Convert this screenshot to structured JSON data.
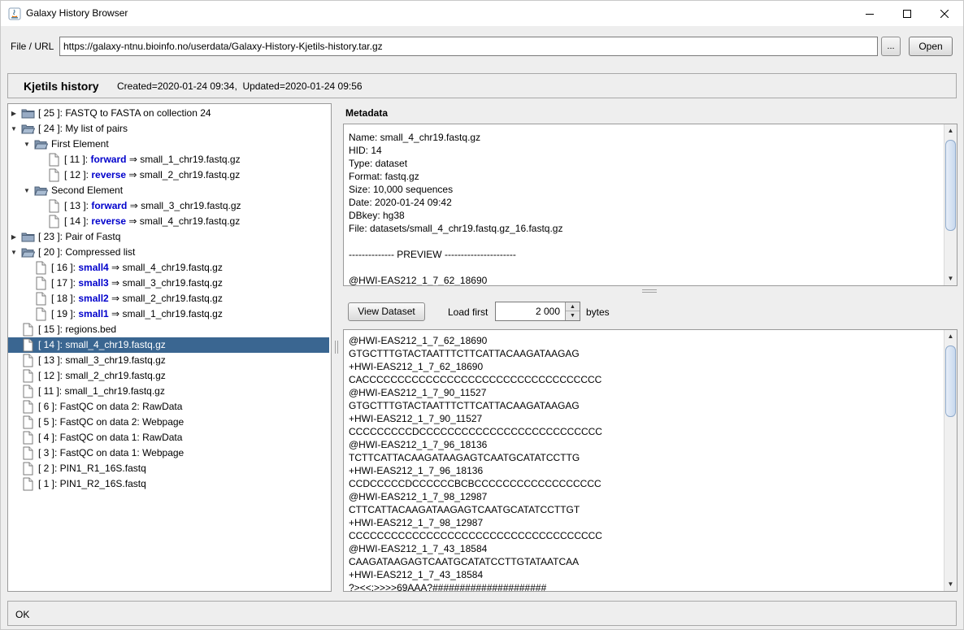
{
  "window": {
    "title": "Galaxy History Browser"
  },
  "url_row": {
    "label": "File / URL",
    "value": "https://galaxy-ntnu.bioinfo.no/userdata/Galaxy-History-Kjetils-history.tar.gz",
    "browse_label": "...",
    "open_label": "Open"
  },
  "history": {
    "name": "Kjetils history",
    "meta": "Created=2020-01-24 09:34,  Updated=2020-01-24 09:56"
  },
  "tree": [
    {
      "level": 0,
      "type": "folder",
      "expander": "right",
      "text": "[ 25 ]: FASTQ to FASTA on collection 24"
    },
    {
      "level": 0,
      "type": "folder-open",
      "expander": "down",
      "text": "[ 24 ]: My list of pairs"
    },
    {
      "level": 1,
      "type": "folder-open",
      "expander": "down",
      "text": "First Element"
    },
    {
      "level": 2,
      "type": "file",
      "prefix": "[ 11 ]: ",
      "label": "forward",
      "suffix": " ⇒ small_1_chr19.fastq.gz"
    },
    {
      "level": 2,
      "type": "file",
      "prefix": "[ 12 ]: ",
      "label": "reverse",
      "suffix": " ⇒ small_2_chr19.fastq.gz"
    },
    {
      "level": 1,
      "type": "folder-open",
      "expander": "down",
      "text": "Second Element"
    },
    {
      "level": 2,
      "type": "file",
      "prefix": "[ 13 ]: ",
      "label": "forward",
      "suffix": " ⇒ small_3_chr19.fastq.gz"
    },
    {
      "level": 2,
      "type": "file",
      "prefix": "[ 14 ]: ",
      "label": "reverse",
      "suffix": " ⇒ small_4_chr19.fastq.gz"
    },
    {
      "level": 0,
      "type": "folder",
      "expander": "right",
      "text": "[ 23 ]: Pair of Fastq"
    },
    {
      "level": 0,
      "type": "folder-open",
      "expander": "down",
      "text": "[ 20 ]: Compressed list"
    },
    {
      "level": 1,
      "type": "file",
      "prefix": "[ 16 ]: ",
      "label": "small4",
      "suffix": " ⇒ small_4_chr19.fastq.gz"
    },
    {
      "level": 1,
      "type": "file",
      "prefix": "[ 17 ]: ",
      "label": "small3",
      "suffix": " ⇒ small_3_chr19.fastq.gz"
    },
    {
      "level": 1,
      "type": "file",
      "prefix": "[ 18 ]: ",
      "label": "small2",
      "suffix": " ⇒ small_2_chr19.fastq.gz"
    },
    {
      "level": 1,
      "type": "file",
      "prefix": "[ 19 ]: ",
      "label": "small1",
      "suffix": " ⇒ small_1_chr19.fastq.gz"
    },
    {
      "level": 0,
      "type": "file",
      "text": "[ 15 ]: regions.bed"
    },
    {
      "level": 0,
      "type": "file",
      "text": "[ 14 ]: small_4_chr19.fastq.gz",
      "selected": true
    },
    {
      "level": 0,
      "type": "file",
      "text": "[ 13 ]: small_3_chr19.fastq.gz"
    },
    {
      "level": 0,
      "type": "file",
      "text": "[ 12 ]: small_2_chr19.fastq.gz"
    },
    {
      "level": 0,
      "type": "file",
      "text": "[ 11 ]: small_1_chr19.fastq.gz"
    },
    {
      "level": 0,
      "type": "file",
      "text": "[ 6 ]: FastQC on data 2: RawData"
    },
    {
      "level": 0,
      "type": "file",
      "text": "[ 5 ]: FastQC on data 2: Webpage"
    },
    {
      "level": 0,
      "type": "file",
      "text": "[ 4 ]: FastQC on data 1: RawData"
    },
    {
      "level": 0,
      "type": "file",
      "text": "[ 3 ]: FastQC on data 1: Webpage"
    },
    {
      "level": 0,
      "type": "file",
      "text": "[ 2 ]: PIN1_R1_16S.fastq"
    },
    {
      "level": 0,
      "type": "file",
      "text": "[ 1 ]: PIN1_R2_16S.fastq"
    }
  ],
  "metadata": {
    "title": "Metadata",
    "lines": [
      "Name: small_4_chr19.fastq.gz",
      "HID: 14",
      "Type: dataset",
      "Format: fastq.gz",
      "Size: 10,000 sequences",
      "Date: 2020-01-24 09:42",
      "DBkey: hg38",
      "File: datasets/small_4_chr19.fastq.gz_16.fastq.gz",
      "",
      "-------------- PREVIEW ----------------------",
      "",
      "@HWI-EAS212_1_7_62_18690"
    ]
  },
  "controls": {
    "view_label": "View Dataset",
    "load_first_label": "Load first",
    "load_first_value": "2 000",
    "bytes_label": "bytes"
  },
  "preview": {
    "lines": [
      "@HWI-EAS212_1_7_62_18690",
      "GTGCTTTGTACTAATTTCTTCATTACAAGATAAGAG",
      "+HWI-EAS212_1_7_62_18690",
      "CACCCCCCCCCCCCCCCCCCCCCCCCCCCCCCCCCC",
      "@HWI-EAS212_1_7_90_11527",
      "GTGCTTTGTACTAATTTCTTCATTACAAGATAAGAG",
      "+HWI-EAS212_1_7_90_11527",
      "CCCCCCCCCDCCCCCCCCCCCCCCCCCCCCCCCCCC",
      "@HWI-EAS212_1_7_96_18136",
      "TCTTCATTACAAGATAAGAGTCAATGCATATCCTTG",
      "+HWI-EAS212_1_7_96_18136",
      "CCDCCCCCDCCCCCCBCBCCCCCCCCCCCCCCCCCC",
      "@HWI-EAS212_1_7_98_12987",
      "CTTCATTACAAGATAAGAGTCAATGCATATCCTTGT",
      "+HWI-EAS212_1_7_98_12987",
      "CCCCCCCCCCCCCCCCCCCCCCCCCCCCCCCCCCCC",
      "@HWI-EAS212_1_7_43_18584",
      "CAAGATAAGAGTCAATGCATATCCTTGTATAATCAA",
      "+HWI-EAS212_1_7_43_18584",
      "?><<:>>>>69AAA?#####################"
    ]
  },
  "status": {
    "text": "OK"
  },
  "colors": {
    "selection": "#3a6691",
    "link_blue": "#0000cc",
    "folder": "#7f94ad"
  }
}
